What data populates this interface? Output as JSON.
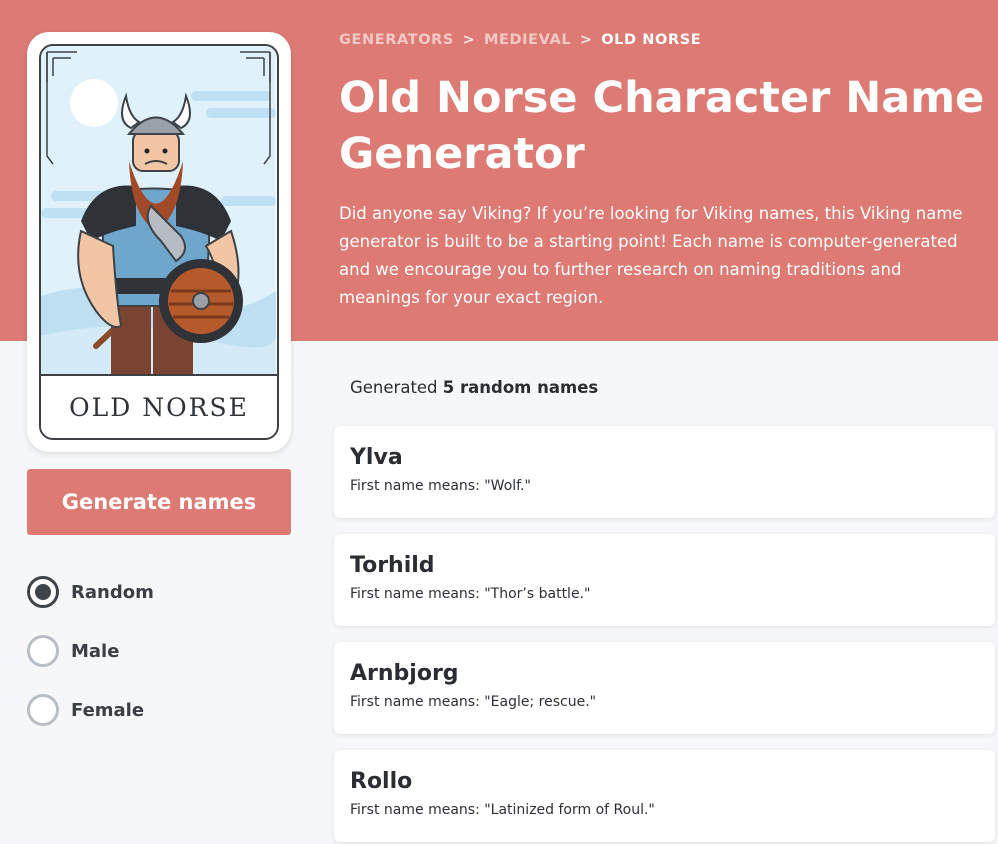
{
  "header": {
    "breadcrumb": [
      {
        "label": "GENERATORS"
      },
      {
        "label": "MEDIEVAL"
      },
      {
        "label": "OLD NORSE"
      }
    ],
    "breadcrumb_separator": ">",
    "title": "Old Norse Character Name Generator",
    "description": "Did anyone say Viking? If you’re looking for Viking names, this Viking name generator is built to be a starting point! Each name is computer-generated and we encourage you to further research on naming traditions and meanings for your exact region."
  },
  "card": {
    "label": "OLD NORSE",
    "illustration": "viking-warrior-illustration"
  },
  "generate_button": {
    "label": "Generate names"
  },
  "gender_options": [
    {
      "label": "Random",
      "selected": true
    },
    {
      "label": "Male",
      "selected": false
    },
    {
      "label": "Female",
      "selected": false
    }
  ],
  "results": {
    "summary_prefix": "Generated",
    "summary_count": "5 random names",
    "names": [
      {
        "name": "Ylva",
        "meaning": "First name means: \"Wolf.\""
      },
      {
        "name": "Torhild",
        "meaning": "First name means: \"Thor’s battle.\""
      },
      {
        "name": "Arnbjorg",
        "meaning": "First name means: \"Eagle; rescue.\""
      },
      {
        "name": "Rollo",
        "meaning": "First name means: \"Latinized form of Roul.\""
      }
    ]
  },
  "colors": {
    "accent": "#dd7a73",
    "background": "#f6f7f9",
    "text_dark": "#2a2d31"
  }
}
